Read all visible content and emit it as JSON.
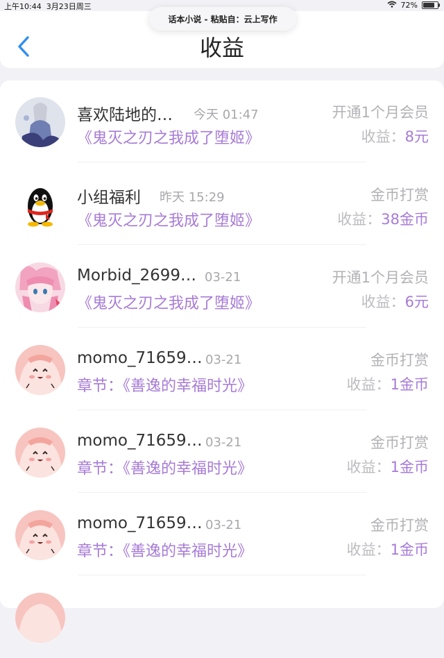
{
  "status_bar": {
    "time": "上午10:44",
    "date": "3月23日周三",
    "battery": "72%"
  },
  "paste_banner": {
    "text": "话本小说 - 粘贴自：云上写作"
  },
  "header": {
    "title": "收益"
  },
  "rows": [
    {
      "name": "喜欢陆地的…",
      "time": "今天 01:47",
      "book": "《鬼灭之刃之我成了堕姬》",
      "type": "开通1个月会员",
      "income_label": "收益：",
      "income_value": "8元",
      "avatar": "avatar-fantasy"
    },
    {
      "name": "小组福利",
      "time": "昨天 15:29",
      "book": "《鬼灭之刃之我成了堕姬》",
      "type": "金币打赏",
      "income_label": "收益：",
      "income_value": "38金币",
      "avatar": "qq-penguin"
    },
    {
      "name": "Morbid_2699…",
      "time": "03-21",
      "book": "《鬼灭之刃之我成了堕姬》",
      "type": "开通1个月会员",
      "income_label": "收益：",
      "income_value": "6元",
      "avatar": "avatar-pink-anime"
    },
    {
      "name": "momo_71659…",
      "time": "03-21",
      "book": "章节：《善逸的幸福时光》",
      "type": "金币打赏",
      "income_label": "收益：",
      "income_value": "1金币",
      "avatar": "avatar-momo"
    },
    {
      "name": "momo_71659…",
      "time": "03-21",
      "book": "章节：《善逸的幸福时光》",
      "type": "金币打赏",
      "income_label": "收益：",
      "income_value": "1金币",
      "avatar": "avatar-momo"
    },
    {
      "name": "momo_71659…",
      "time": "03-21",
      "book": "章节：《善逸的幸福时光》",
      "type": "金币打赏",
      "income_label": "收益：",
      "income_value": "1金币",
      "avatar": "avatar-momo"
    }
  ]
}
